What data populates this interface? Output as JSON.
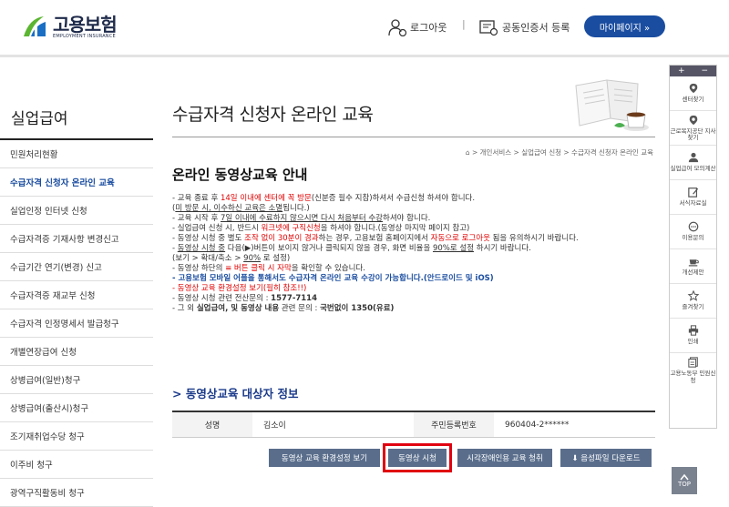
{
  "header": {
    "logo_title": "고용보험",
    "logo_sub": "EMPLOYMENT INSURANCE",
    "logout_label": "로그아웃",
    "separator": "|",
    "cert_label": "공동인증서 등록",
    "mypage_label": "마이페이지  »"
  },
  "sidebar": {
    "title": "실업급여",
    "items": [
      {
        "label": "민원처리현황"
      },
      {
        "label": "수급자격 신청자 온라인 교육"
      },
      {
        "label": "실업인정 인터넷 신청"
      },
      {
        "label": "수급자격증 기재사항 변경신고"
      },
      {
        "label": "수급기간 연기(변경) 신고"
      },
      {
        "label": "수급자격증 재교부 신청"
      },
      {
        "label": "수급자격 인정명세서 발급청구"
      },
      {
        "label": "개별연장급여 신청"
      },
      {
        "label": "상병급여(일반)청구"
      },
      {
        "label": "상병급여(출산시)청구"
      },
      {
        "label": "조기재취업수당 청구"
      },
      {
        "label": "이주비 청구"
      },
      {
        "label": "광역구직활동비 청구"
      }
    ]
  },
  "main": {
    "page_title": "수급자격 신청자 온라인 교육",
    "breadcrumb": "⌂ > 개인서비스 > 실업급여 신청 > 수급자격 신청자 온라인 교육",
    "heading": "온라인 동영상교육 안내",
    "notes": [
      {
        "parts": [
          "- 교육 종료 후 ",
          "14일 이내에 센터에 꼭 방문",
          "(신분증 필수 지참)하셔서 수급신청 하셔야 합니다."
        ]
      },
      {
        "parts": [
          "  (",
          "미 방문 시, 이수하신 교육은 소멸",
          "됩니다.)"
        ]
      },
      {
        "parts": [
          "- 교육 시작 후 ",
          "7일 이내에 수료하지 않으시면 다시 처음부터 수강",
          "하셔야 합니다."
        ]
      },
      {
        "parts": [
          "- 실업급여 신청 시, 반드시 ",
          "워크넷에 구직신청",
          "을 하셔야 합니다.(동영상 마지막 페이지 참고)"
        ]
      },
      {
        "parts": [
          "- 동영상 시청 중 별도 ",
          "조작 없이 30분이 경과",
          "하는 경우, 고용보험 홈페이지에서 ",
          "자동으로 로그아웃",
          " 됨을 유의하시기 바랍니다."
        ]
      },
      {
        "parts": [
          "- ",
          "동영상 시청 중",
          " 다음(▶)버튼이 보이지 않거나 클릭되지 않을 경우, 화면 비율을 ",
          "90%로 설정",
          " 하시기 바랍니다."
        ]
      },
      {
        "parts": [
          "  (보기 > 확대/축소 > ",
          "90%",
          " 로 설정)"
        ]
      },
      {
        "parts": [
          "- 동영상 하단의 ",
          "≡ 버튼 클릭 시 자막",
          "을 확인할 수 있습니다."
        ]
      },
      {
        "parts": [
          "- 고용보험 모바일 어플을 통해서도 수급자격 온라인 교육 수강이 가능합니다.(안드로이드 및 iOS)"
        ]
      },
      {
        "parts": [
          "- 동영상 교육 환경설정 보기(필히 참조!!)"
        ]
      },
      {
        "parts": [
          "- 동영상 시청 관련 전산문의 : ",
          "1577-7114"
        ]
      },
      {
        "parts": [
          "- 그 외 ",
          "실업급여, 및 동영상 내용",
          " 관련 문의 : ",
          "국번없이 1350(유료)"
        ]
      }
    ],
    "section_title": "동영상교육 대상자 정보",
    "table": {
      "name_header": "성명",
      "name_value": "김소이",
      "rrn_header": "주민등록번호",
      "rrn_value": "960404-2******"
    },
    "buttons": {
      "env": "동영상 교육 환경설정 보기",
      "watch": "동영상 시청",
      "accessible": "시각장애인용 교육 청취",
      "audio": "⬇ 음성파일 다운로드"
    }
  },
  "quick": {
    "plus": "+",
    "minus": "−",
    "items": [
      {
        "label": "센터찾기",
        "icon": "map-pin-icon"
      },
      {
        "label": "근로복지공단 지사찾기",
        "icon": "map-pin-icon"
      },
      {
        "label": "실업급여 모의계산",
        "icon": "user-icon"
      },
      {
        "label": "서식자료실",
        "icon": "edit-icon"
      },
      {
        "label": "이용문의",
        "icon": "chat-icon"
      },
      {
        "label": "개선제안",
        "icon": "cup-icon"
      },
      {
        "label": "즐겨찾기",
        "icon": "star-icon"
      },
      {
        "label": "인쇄",
        "icon": "print-icon"
      },
      {
        "label": "고용노동부 민원신청",
        "icon": "document-icon"
      }
    ],
    "top_label": "TOP"
  }
}
